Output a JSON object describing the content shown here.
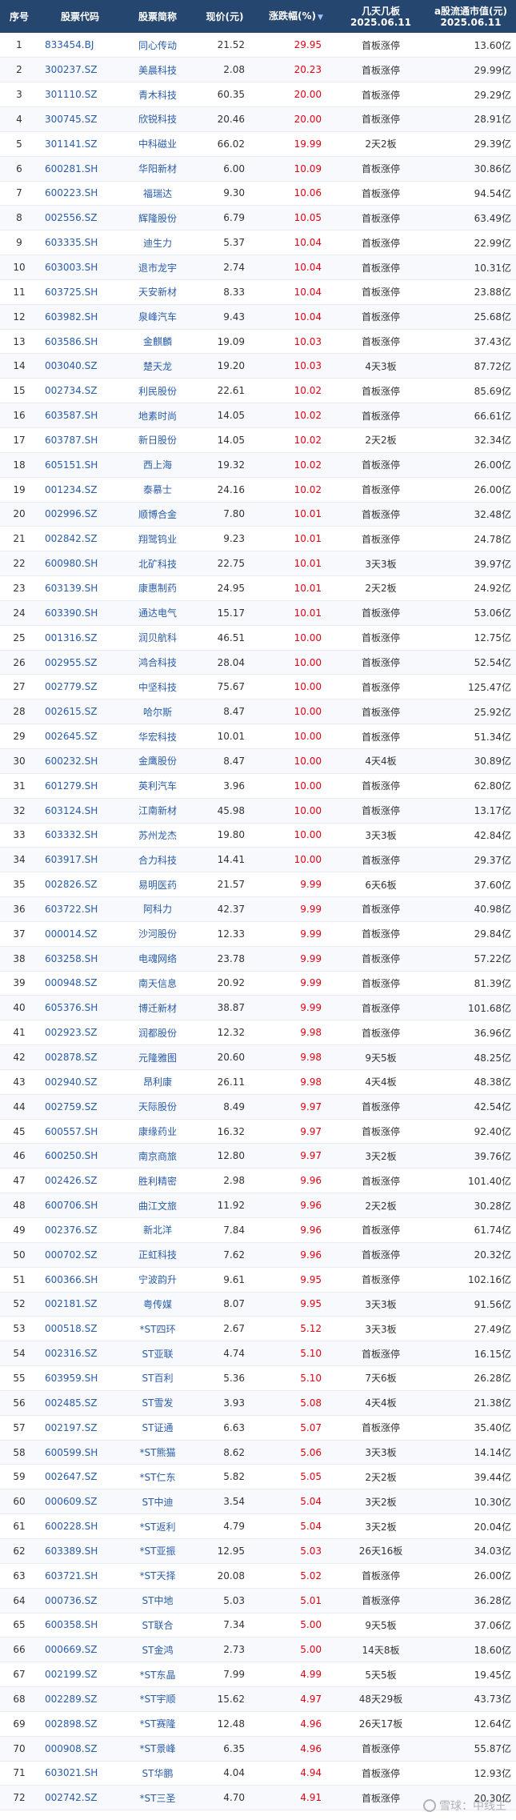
{
  "header": {
    "seq": "序号",
    "code": "股票代码",
    "name": "股票简称",
    "price": "现价(元)",
    "change": "涨跌幅(%)",
    "sort_arrow": "▼",
    "days_line1": "几天几板",
    "days_line2": "2025.06.11",
    "cap_line1": "a股流通市值(元)",
    "cap_line2": "2025.06.11"
  },
  "watermark": "雪球：中线王",
  "rows": [
    {
      "seq": "1",
      "code": "833454.BJ",
      "name": "同心传动",
      "price": "21.52",
      "change": "29.95",
      "days": "首板涨停",
      "cap": "13.60亿"
    },
    {
      "seq": "2",
      "code": "300237.SZ",
      "name": "美晨科技",
      "price": "2.08",
      "change": "20.23",
      "days": "首板涨停",
      "cap": "29.99亿"
    },
    {
      "seq": "3",
      "code": "301110.SZ",
      "name": "青木科技",
      "price": "60.35",
      "change": "20.00",
      "days": "首板涨停",
      "cap": "29.29亿"
    },
    {
      "seq": "4",
      "code": "300745.SZ",
      "name": "欣锐科技",
      "price": "20.46",
      "change": "20.00",
      "days": "首板涨停",
      "cap": "28.91亿"
    },
    {
      "seq": "5",
      "code": "301141.SZ",
      "name": "中科磁业",
      "price": "66.02",
      "change": "19.99",
      "days": "2天2板",
      "cap": "29.39亿"
    },
    {
      "seq": "6",
      "code": "600281.SH",
      "name": "华阳新材",
      "price": "6.00",
      "change": "10.09",
      "days": "首板涨停",
      "cap": "30.86亿"
    },
    {
      "seq": "7",
      "code": "600223.SH",
      "name": "福瑞达",
      "price": "9.30",
      "change": "10.06",
      "days": "首板涨停",
      "cap": "94.54亿"
    },
    {
      "seq": "8",
      "code": "002556.SZ",
      "name": "辉隆股份",
      "price": "6.79",
      "change": "10.05",
      "days": "首板涨停",
      "cap": "63.49亿"
    },
    {
      "seq": "9",
      "code": "603335.SH",
      "name": "迪生力",
      "price": "5.37",
      "change": "10.04",
      "days": "首板涨停",
      "cap": "22.99亿"
    },
    {
      "seq": "10",
      "code": "603003.SH",
      "name": "退市龙宇",
      "price": "2.74",
      "change": "10.04",
      "days": "首板涨停",
      "cap": "10.31亿"
    },
    {
      "seq": "11",
      "code": "603725.SH",
      "name": "天安新材",
      "price": "8.33",
      "change": "10.04",
      "days": "首板涨停",
      "cap": "23.88亿"
    },
    {
      "seq": "12",
      "code": "603982.SH",
      "name": "泉峰汽车",
      "price": "9.43",
      "change": "10.04",
      "days": "首板涨停",
      "cap": "25.68亿"
    },
    {
      "seq": "13",
      "code": "603586.SH",
      "name": "金麒麟",
      "price": "19.09",
      "change": "10.03",
      "days": "首板涨停",
      "cap": "37.43亿"
    },
    {
      "seq": "14",
      "code": "003040.SZ",
      "name": "楚天龙",
      "price": "19.20",
      "change": "10.03",
      "days": "4天3板",
      "cap": "87.72亿"
    },
    {
      "seq": "15",
      "code": "002734.SZ",
      "name": "利民股份",
      "price": "22.61",
      "change": "10.02",
      "days": "首板涨停",
      "cap": "85.69亿"
    },
    {
      "seq": "16",
      "code": "603587.SH",
      "name": "地素时尚",
      "price": "14.05",
      "change": "10.02",
      "days": "首板涨停",
      "cap": "66.61亿"
    },
    {
      "seq": "17",
      "code": "603787.SH",
      "name": "新日股份",
      "price": "14.05",
      "change": "10.02",
      "days": "2天2板",
      "cap": "32.34亿"
    },
    {
      "seq": "18",
      "code": "605151.SH",
      "name": "西上海",
      "price": "19.32",
      "change": "10.02",
      "days": "首板涨停",
      "cap": "26.00亿"
    },
    {
      "seq": "19",
      "code": "001234.SZ",
      "name": "泰慕士",
      "price": "24.16",
      "change": "10.02",
      "days": "首板涨停",
      "cap": "26.00亿"
    },
    {
      "seq": "20",
      "code": "002996.SZ",
      "name": "顺博合金",
      "price": "7.80",
      "change": "10.01",
      "days": "首板涨停",
      "cap": "32.48亿"
    },
    {
      "seq": "21",
      "code": "002842.SZ",
      "name": "翔鹭钨业",
      "price": "9.23",
      "change": "10.01",
      "days": "首板涨停",
      "cap": "24.78亿"
    },
    {
      "seq": "22",
      "code": "600980.SH",
      "name": "北矿科技",
      "price": "22.75",
      "change": "10.01",
      "days": "3天3板",
      "cap": "39.97亿"
    },
    {
      "seq": "23",
      "code": "603139.SH",
      "name": "康惠制药",
      "price": "24.95",
      "change": "10.01",
      "days": "2天2板",
      "cap": "24.92亿"
    },
    {
      "seq": "24",
      "code": "603390.SH",
      "name": "通达电气",
      "price": "15.17",
      "change": "10.01",
      "days": "首板涨停",
      "cap": "53.06亿"
    },
    {
      "seq": "25",
      "code": "001316.SZ",
      "name": "润贝航科",
      "price": "46.51",
      "change": "10.00",
      "days": "首板涨停",
      "cap": "12.75亿"
    },
    {
      "seq": "26",
      "code": "002955.SZ",
      "name": "鸿合科技",
      "price": "28.04",
      "change": "10.00",
      "days": "首板涨停",
      "cap": "52.54亿"
    },
    {
      "seq": "27",
      "code": "002779.SZ",
      "name": "中坚科技",
      "price": "75.67",
      "change": "10.00",
      "days": "首板涨停",
      "cap": "125.47亿"
    },
    {
      "seq": "28",
      "code": "002615.SZ",
      "name": "哈尔斯",
      "price": "8.47",
      "change": "10.00",
      "days": "首板涨停",
      "cap": "25.92亿"
    },
    {
      "seq": "29",
      "code": "002645.SZ",
      "name": "华宏科技",
      "price": "10.01",
      "change": "10.00",
      "days": "首板涨停",
      "cap": "51.34亿"
    },
    {
      "seq": "30",
      "code": "600232.SH",
      "name": "金鹰股份",
      "price": "8.47",
      "change": "10.00",
      "days": "4天4板",
      "cap": "30.89亿"
    },
    {
      "seq": "31",
      "code": "601279.SH",
      "name": "英利汽车",
      "price": "3.96",
      "change": "10.00",
      "days": "首板涨停",
      "cap": "62.80亿"
    },
    {
      "seq": "32",
      "code": "603124.SH",
      "name": "江南新材",
      "price": "45.98",
      "change": "10.00",
      "days": "首板涨停",
      "cap": "13.17亿"
    },
    {
      "seq": "33",
      "code": "603332.SH",
      "name": "苏州龙杰",
      "price": "19.80",
      "change": "10.00",
      "days": "3天3板",
      "cap": "42.84亿"
    },
    {
      "seq": "34",
      "code": "603917.SH",
      "name": "合力科技",
      "price": "14.41",
      "change": "10.00",
      "days": "首板涨停",
      "cap": "29.37亿"
    },
    {
      "seq": "35",
      "code": "002826.SZ",
      "name": "易明医药",
      "price": "21.57",
      "change": "9.99",
      "days": "6天6板",
      "cap": "37.60亿"
    },
    {
      "seq": "36",
      "code": "603722.SH",
      "name": "阿科力",
      "price": "42.37",
      "change": "9.99",
      "days": "首板涨停",
      "cap": "40.98亿"
    },
    {
      "seq": "37",
      "code": "000014.SZ",
      "name": "沙河股份",
      "price": "12.33",
      "change": "9.99",
      "days": "首板涨停",
      "cap": "29.84亿"
    },
    {
      "seq": "38",
      "code": "603258.SH",
      "name": "电魂网络",
      "price": "23.78",
      "change": "9.99",
      "days": "首板涨停",
      "cap": "57.22亿"
    },
    {
      "seq": "39",
      "code": "000948.SZ",
      "name": "南天信息",
      "price": "20.92",
      "change": "9.99",
      "days": "首板涨停",
      "cap": "81.39亿"
    },
    {
      "seq": "40",
      "code": "605376.SH",
      "name": "博迁新材",
      "price": "38.87",
      "change": "9.99",
      "days": "首板涨停",
      "cap": "101.68亿"
    },
    {
      "seq": "41",
      "code": "002923.SZ",
      "name": "润都股份",
      "price": "12.32",
      "change": "9.98",
      "days": "首板涨停",
      "cap": "36.96亿"
    },
    {
      "seq": "42",
      "code": "002878.SZ",
      "name": "元隆雅图",
      "price": "20.60",
      "change": "9.98",
      "days": "9天5板",
      "cap": "48.25亿"
    },
    {
      "seq": "43",
      "code": "002940.SZ",
      "name": "昂利康",
      "price": "26.11",
      "change": "9.98",
      "days": "4天4板",
      "cap": "48.38亿"
    },
    {
      "seq": "44",
      "code": "002759.SZ",
      "name": "天际股份",
      "price": "8.49",
      "change": "9.97",
      "days": "首板涨停",
      "cap": "42.54亿"
    },
    {
      "seq": "45",
      "code": "600557.SH",
      "name": "康缘药业",
      "price": "16.32",
      "change": "9.97",
      "days": "首板涨停",
      "cap": "92.40亿"
    },
    {
      "seq": "46",
      "code": "600250.SH",
      "name": "南京商旅",
      "price": "12.80",
      "change": "9.97",
      "days": "3天2板",
      "cap": "39.76亿"
    },
    {
      "seq": "47",
      "code": "002426.SZ",
      "name": "胜利精密",
      "price": "2.98",
      "change": "9.96",
      "days": "首板涨停",
      "cap": "101.40亿"
    },
    {
      "seq": "48",
      "code": "600706.SH",
      "name": "曲江文旅",
      "price": "11.92",
      "change": "9.96",
      "days": "2天2板",
      "cap": "30.28亿"
    },
    {
      "seq": "49",
      "code": "002376.SZ",
      "name": "新北洋",
      "price": "7.84",
      "change": "9.96",
      "days": "首板涨停",
      "cap": "61.74亿"
    },
    {
      "seq": "50",
      "code": "000702.SZ",
      "name": "正虹科技",
      "price": "7.62",
      "change": "9.96",
      "days": "首板涨停",
      "cap": "20.32亿"
    },
    {
      "seq": "51",
      "code": "600366.SH",
      "name": "宁波韵升",
      "price": "9.61",
      "change": "9.95",
      "days": "首板涨停",
      "cap": "102.16亿"
    },
    {
      "seq": "52",
      "code": "002181.SZ",
      "name": "粤传媒",
      "price": "8.07",
      "change": "9.95",
      "days": "3天3板",
      "cap": "91.56亿"
    },
    {
      "seq": "53",
      "code": "000518.SZ",
      "name": "*ST四环",
      "price": "2.67",
      "change": "5.12",
      "days": "3天3板",
      "cap": "27.49亿"
    },
    {
      "seq": "54",
      "code": "002316.SZ",
      "name": "ST亚联",
      "price": "4.74",
      "change": "5.10",
      "days": "首板涨停",
      "cap": "16.15亿"
    },
    {
      "seq": "55",
      "code": "603959.SH",
      "name": "ST百利",
      "price": "5.36",
      "change": "5.10",
      "days": "7天6板",
      "cap": "26.28亿"
    },
    {
      "seq": "56",
      "code": "002485.SZ",
      "name": "ST雪发",
      "price": "3.93",
      "change": "5.08",
      "days": "4天4板",
      "cap": "21.38亿"
    },
    {
      "seq": "57",
      "code": "002197.SZ",
      "name": "ST证通",
      "price": "6.63",
      "change": "5.07",
      "days": "首板涨停",
      "cap": "35.40亿"
    },
    {
      "seq": "58",
      "code": "600599.SH",
      "name": "*ST熊猫",
      "price": "8.62",
      "change": "5.06",
      "days": "3天3板",
      "cap": "14.14亿"
    },
    {
      "seq": "59",
      "code": "002647.SZ",
      "name": "*ST仁东",
      "price": "5.82",
      "change": "5.05",
      "days": "2天2板",
      "cap": "39.44亿"
    },
    {
      "seq": "60",
      "code": "000609.SZ",
      "name": "ST中迪",
      "price": "3.54",
      "change": "5.04",
      "days": "3天2板",
      "cap": "10.30亿"
    },
    {
      "seq": "61",
      "code": "600228.SH",
      "name": "*ST返利",
      "price": "4.79",
      "change": "5.04",
      "days": "3天2板",
      "cap": "20.04亿"
    },
    {
      "seq": "62",
      "code": "603389.SH",
      "name": "*ST亚振",
      "price": "12.95",
      "change": "5.03",
      "days": "26天16板",
      "cap": "34.03亿"
    },
    {
      "seq": "63",
      "code": "603721.SH",
      "name": "*ST天择",
      "price": "20.08",
      "change": "5.02",
      "days": "首板涨停",
      "cap": "26.00亿"
    },
    {
      "seq": "64",
      "code": "000736.SZ",
      "name": "ST中地",
      "price": "5.03",
      "change": "5.01",
      "days": "首板涨停",
      "cap": "36.28亿"
    },
    {
      "seq": "65",
      "code": "600358.SH",
      "name": "ST联合",
      "price": "7.34",
      "change": "5.00",
      "days": "9天5板",
      "cap": "37.06亿"
    },
    {
      "seq": "66",
      "code": "000669.SZ",
      "name": "ST金鸿",
      "price": "2.73",
      "change": "5.00",
      "days": "14天8板",
      "cap": "18.60亿"
    },
    {
      "seq": "67",
      "code": "002199.SZ",
      "name": "*ST东晶",
      "price": "7.99",
      "change": "4.99",
      "days": "5天5板",
      "cap": "19.45亿"
    },
    {
      "seq": "68",
      "code": "002289.SZ",
      "name": "*ST宇顺",
      "price": "15.62",
      "change": "4.97",
      "days": "48天29板",
      "cap": "43.73亿"
    },
    {
      "seq": "69",
      "code": "002898.SZ",
      "name": "*ST赛隆",
      "price": "12.48",
      "change": "4.96",
      "days": "26天17板",
      "cap": "12.64亿"
    },
    {
      "seq": "70",
      "code": "000908.SZ",
      "name": "*ST景峰",
      "price": "6.35",
      "change": "4.96",
      "days": "首板涨停",
      "cap": "55.87亿"
    },
    {
      "seq": "71",
      "code": "603021.SH",
      "name": "ST华鹏",
      "price": "4.04",
      "change": "4.94",
      "days": "首板涨停",
      "cap": "12.93亿"
    },
    {
      "seq": "72",
      "code": "002742.SZ",
      "name": "*ST三圣",
      "price": "4.70",
      "change": "4.91",
      "days": "首板涨停",
      "cap": "20.30亿"
    }
  ]
}
